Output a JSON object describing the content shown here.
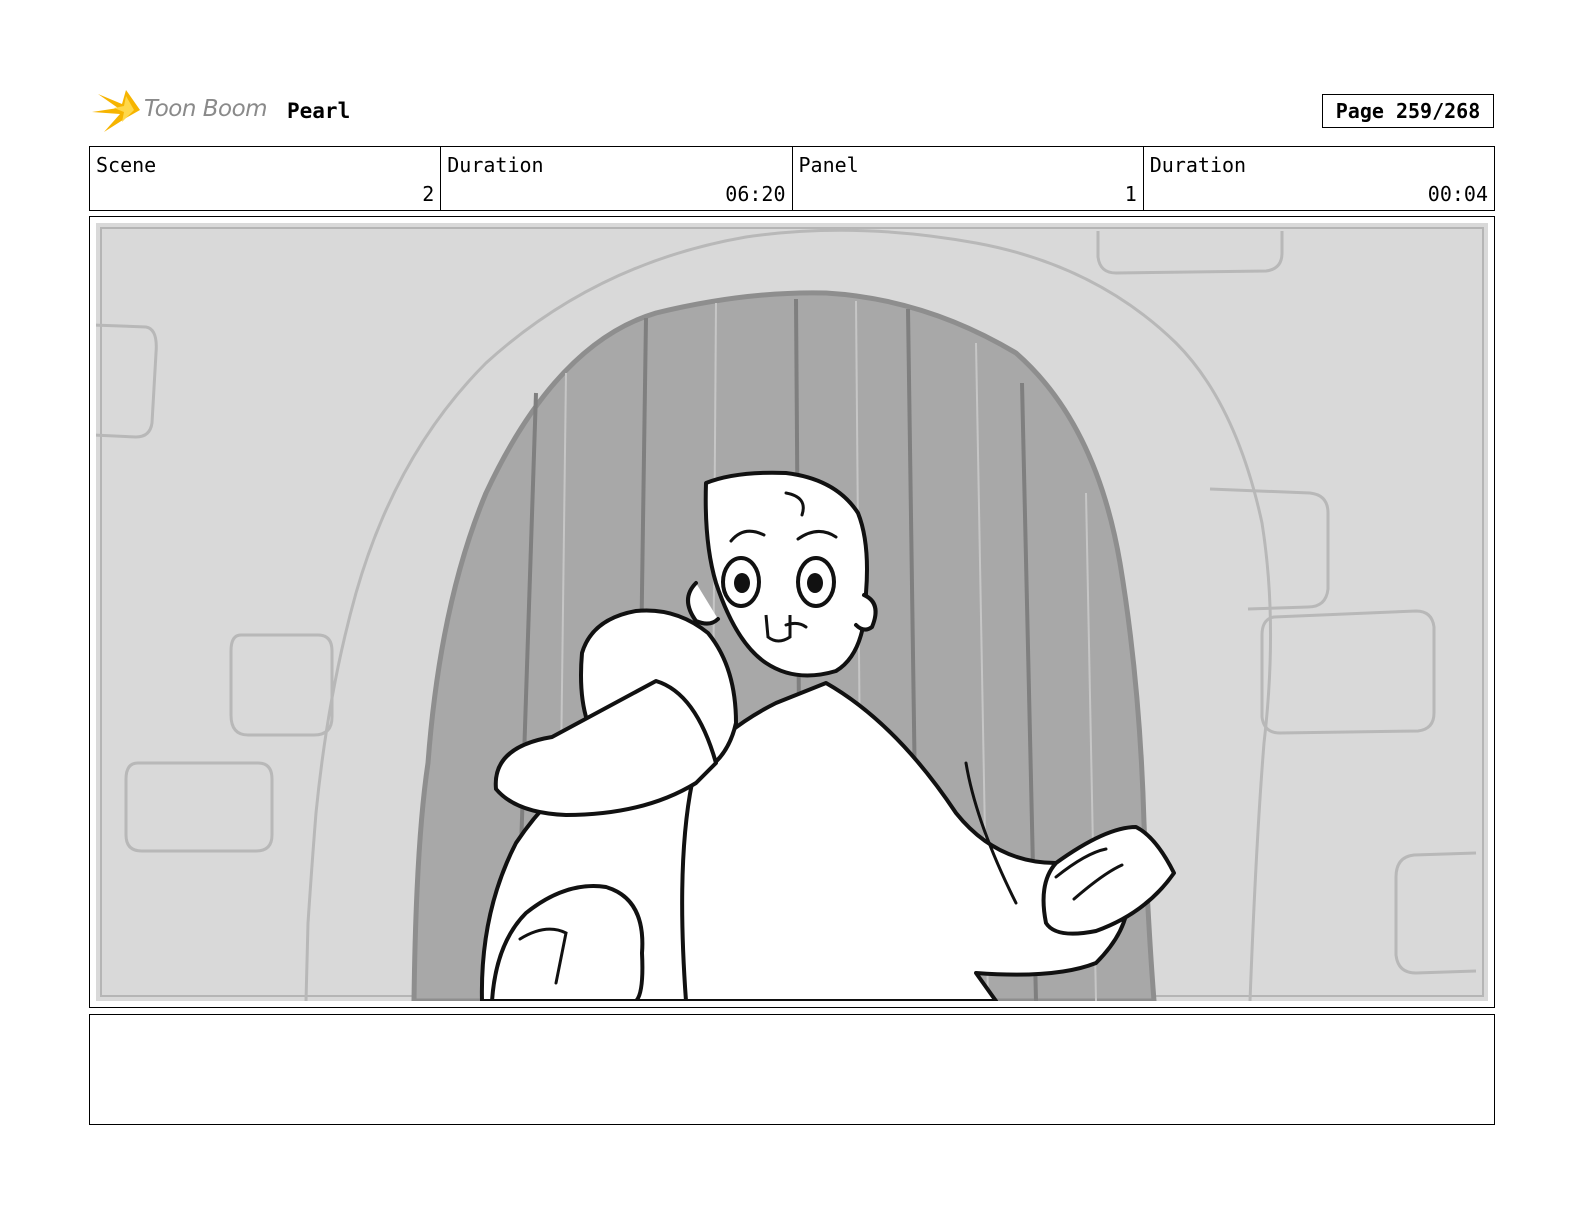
{
  "header": {
    "logo_text": "Toon Boom",
    "project_title": "Pearl",
    "page_label": "Page 259/268"
  },
  "info": {
    "scene_label": "Scene",
    "scene_value": "2",
    "scene_duration_label": "Duration",
    "scene_duration_value": "06:20",
    "panel_label": "Panel",
    "panel_value": "1",
    "panel_duration_label": "Duration",
    "panel_duration_value": "00:04"
  },
  "notes": {
    "text": ""
  }
}
